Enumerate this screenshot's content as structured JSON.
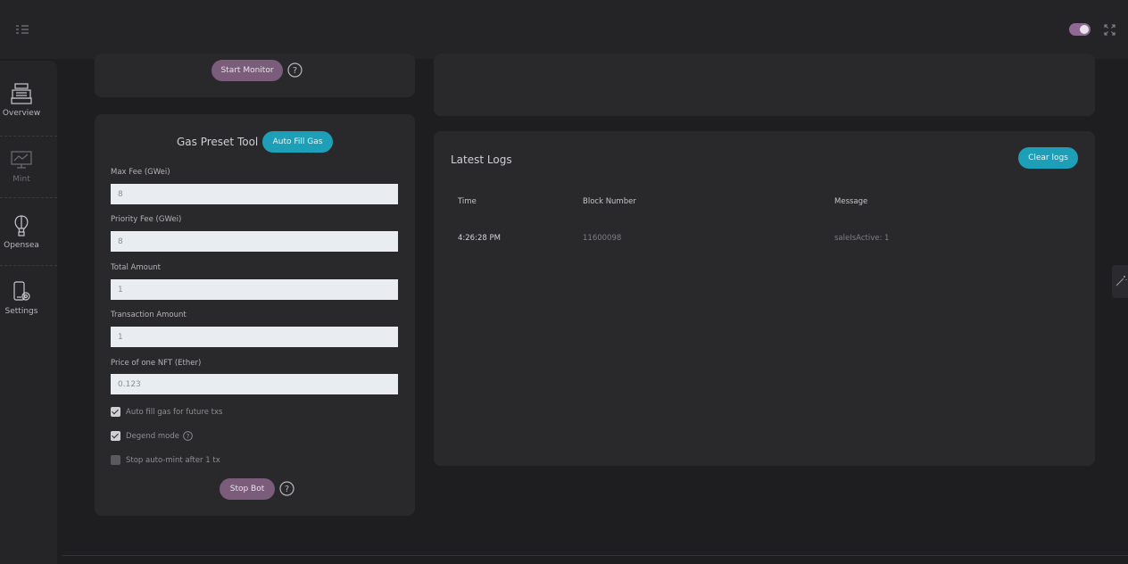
{
  "topbar": {
    "menu_icon": "menu-list-icon",
    "theme_toggle_on": true,
    "fullscreen_icon": "fullscreen-icon"
  },
  "sidebar": {
    "items": [
      {
        "label": "Overview",
        "icon": "cash-register-icon"
      },
      {
        "label": "Mint",
        "icon": "monitor-chart-icon"
      },
      {
        "label": "Opensea",
        "icon": "hot-air-balloon-icon"
      },
      {
        "label": "Settings",
        "icon": "phone-settings-icon"
      }
    ]
  },
  "monitor_card": {
    "start_button": "Start Monitor"
  },
  "gas_tool": {
    "title": "Gas Preset Tool",
    "auto_fill_button": "Auto Fill Gas",
    "fields": [
      {
        "label": "Max Fee (GWei)",
        "value": "8"
      },
      {
        "label": "Priority Fee (GWei)",
        "value": "8"
      },
      {
        "label": "Total Amount",
        "value": "1"
      },
      {
        "label": "Transaction Amount",
        "value": "1"
      },
      {
        "label": "Price of one NFT (Ether)",
        "value": "0.123"
      }
    ],
    "checkboxes": [
      {
        "label": "Auto fill gas for future txs",
        "checked": true
      },
      {
        "label": "Degend mode",
        "checked": true
      },
      {
        "label": "Stop auto-mint after 1 tx",
        "checked": false
      }
    ],
    "stop_button": "Stop Bot"
  },
  "logs": {
    "title": "Latest Logs",
    "clear_button": "Clear logs",
    "columns": [
      "Time",
      "Block Number",
      "Message"
    ],
    "rows": [
      {
        "time": "4:26:28 PM",
        "block": "11600098",
        "message": "saleIsActive: 1"
      }
    ]
  },
  "colors": {
    "accent_teal": "#1d9fb7",
    "accent_purple": "#7b5c7a",
    "background": "#1e1d20",
    "card": "#29282b"
  }
}
